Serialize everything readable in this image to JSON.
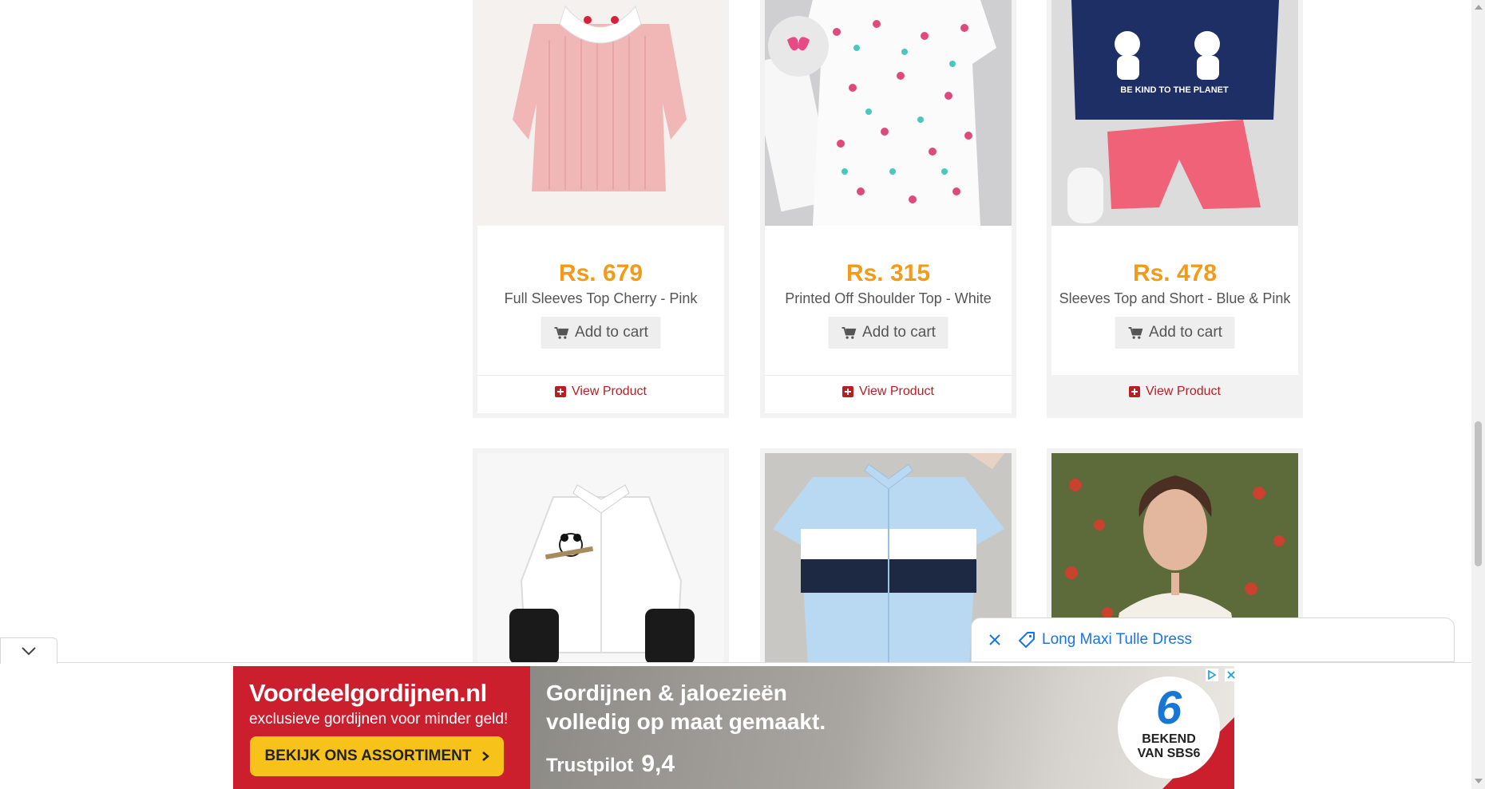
{
  "products_row1": [
    {
      "price": "Rs. 679",
      "title": "Full Sleeves Top Cherry - Pink",
      "cart_label": "Add to cart",
      "view_label": "View Product"
    },
    {
      "price": "Rs. 315",
      "title": "Printed Off Shoulder Top - White",
      "cart_label": "Add to cart",
      "view_label": "View Product"
    },
    {
      "price": "Rs. 478",
      "title": "Sleeves Top and Short - Blue & Pink",
      "cart_label": "Add to cart",
      "view_label": "View Product"
    }
  ],
  "product_images": {
    "img1": {
      "icon": "pink-top-image"
    },
    "img2": {
      "icon": "butterfly-top-image"
    },
    "img3": {
      "icon": "top-and-short-image",
      "print_line1": "BE KIND TO THE PLANET"
    },
    "img4": {
      "icon": "panda-shirt-image"
    },
    "img5": {
      "icon": "striped-shirt-image"
    },
    "img6": {
      "icon": "maxi-dress-image"
    }
  },
  "toast": {
    "label": "Long Maxi Tulle Dress"
  },
  "ad": {
    "brand": "Voordeelgordijnen.nl",
    "tagline": "exclusieve gordijnen voor minder geld!",
    "cta": "BEKIJK ONS ASSORTIMENT",
    "headline_line1": "Gordijnen & jaloezieën",
    "headline_line2": "volledig op maat gemaakt.",
    "trust_label": "Trustpilot",
    "trust_score": "9,4",
    "badge_number": "6",
    "badge_text_line1": "BEKEND",
    "badge_text_line2": "VAN SBS6"
  },
  "colors": {
    "price": "#f39a17",
    "link": "#b81f25",
    "toast_link": "#1a73e8",
    "ad_red": "#cc1f2d",
    "ad_cta": "#f7c31b"
  }
}
